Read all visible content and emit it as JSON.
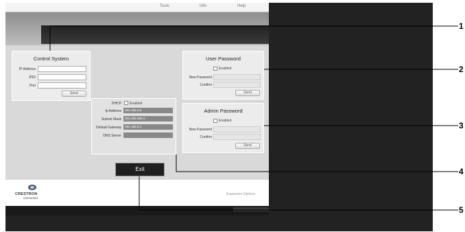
{
  "menu": [
    "Tools",
    "Info",
    "Help"
  ],
  "control_system": {
    "title": "Control System",
    "fields": [
      "IP Address",
      "IPID",
      "Port"
    ],
    "send": "Send"
  },
  "user_password": {
    "title": "User Password",
    "enabled_label": "Enabled",
    "new_password_label": "New Password",
    "confirm_label": "Confirm",
    "send": "Send"
  },
  "admin_password": {
    "title": "Admin Password",
    "enabled_label": "Enabled",
    "new_password_label": "New Password",
    "confirm_label": "Confirm",
    "send": "Send"
  },
  "network": {
    "dhcp_label": "DHCP",
    "dhcp_enabled_label": "Enabled",
    "rows": [
      {
        "label": "Ip Address",
        "value": "192.168.0.8"
      },
      {
        "label": "Subnet Mask",
        "value": "255.255.255.0"
      },
      {
        "label": "Default Gateway",
        "value": "192.168.0.1"
      },
      {
        "label": "DNS Server",
        "value": ""
      }
    ]
  },
  "exit_label": "Exit",
  "footer": {
    "logo_text": "CRESTRON",
    "logo_sub": "connected",
    "expansion_options": "Expansion Options"
  },
  "callouts": [
    "1",
    "2",
    "3",
    "4",
    "5"
  ],
  "colors": {
    "dark_bg": "#222222",
    "panel_bg": "#ececec",
    "value_bg": "#888888"
  }
}
